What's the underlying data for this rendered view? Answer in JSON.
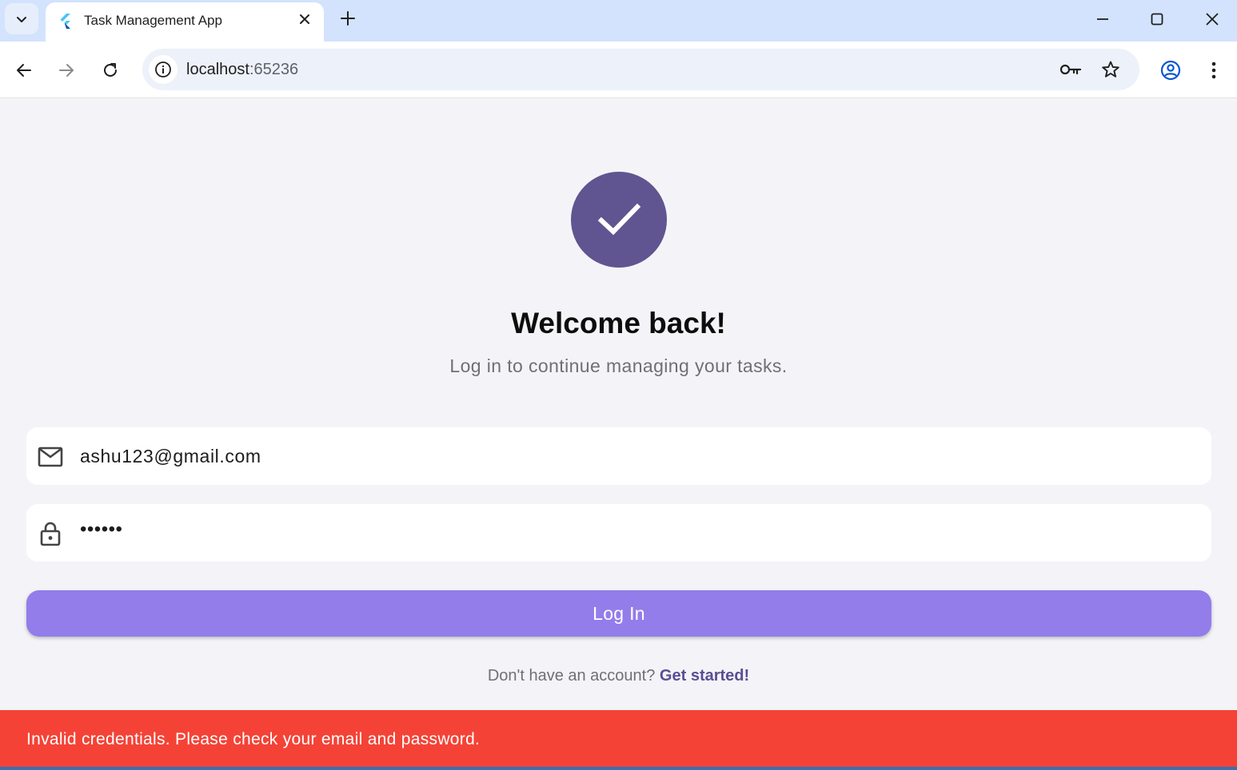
{
  "browser": {
    "tab_title": "Task Management App",
    "address_host": "localhost",
    "address_port": ":65236"
  },
  "icons": {
    "tab_search": "chevron-down-icon",
    "favicon": "flutter-logo-icon",
    "tab_close": "close-icon",
    "new_tab": "plus-icon",
    "minimize": "minimize-icon",
    "maximize": "maximize-icon",
    "close_window": "close-icon",
    "back": "arrow-left-icon",
    "forward": "arrow-right-icon",
    "reload": "reload-icon",
    "site_info": "info-icon",
    "passwords": "key-icon",
    "bookmark": "star-icon",
    "profile": "account-circle-icon",
    "menu": "more-vert-icon",
    "app_logo": "check-icon",
    "email": "mail-icon",
    "password": "lock-icon"
  },
  "colors": {
    "logo_bg": "#605590",
    "button_bg": "#937dea",
    "link": "#5a4e93",
    "snackbar_bg": "#f44336",
    "page_bg": "#f4f4f8"
  },
  "login": {
    "title": "Welcome back!",
    "subtitle": "Log in to continue managing your tasks.",
    "email_value": "ashu123@gmail.com",
    "password_value": "••••••",
    "button_label": "Log In",
    "signup_prompt": "Don't have an account?",
    "signup_link": "Get started!"
  },
  "snackbar": {
    "message": "Invalid credentials. Please check your email and password."
  }
}
